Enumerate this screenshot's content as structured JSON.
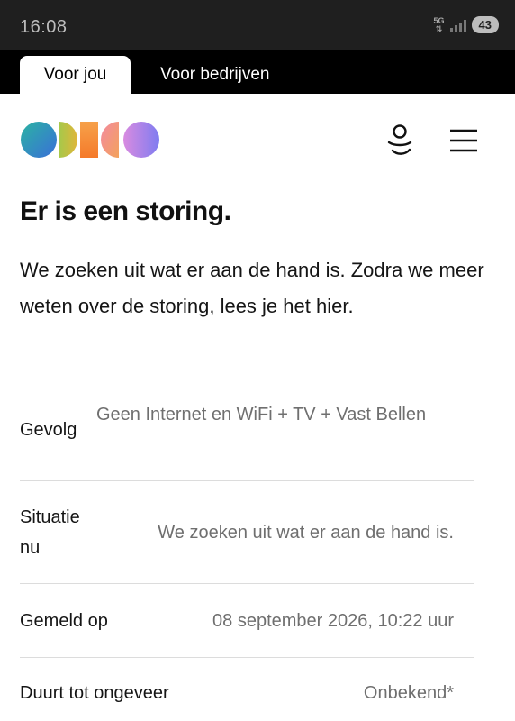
{
  "status_bar": {
    "time": "16:08",
    "network": "5G",
    "battery": "43"
  },
  "tabs": [
    {
      "label": "Voor jou",
      "active": true
    },
    {
      "label": "Voor bedrijven",
      "active": false
    }
  ],
  "header": {
    "logo_icon": "brand-logo",
    "user_icon": "user-icon",
    "menu_icon": "hamburger-menu-icon"
  },
  "colors": {
    "tab_bar": "#000000",
    "status_bar": "#1f1f1f",
    "value_text": "#6f6f6f"
  },
  "main": {
    "title": "Er is een storing.",
    "intro": "We zoeken uit wat er aan de hand is. Zodra we meer weten over de storing, lees je het hier.",
    "rows": [
      {
        "label": "Gevolg",
        "value": "Geen Internet en WiFi + TV + Vast Bellen"
      },
      {
        "label": "Situatie nu",
        "value": "We zoeken uit wat er aan de hand is."
      },
      {
        "label": "Gemeld op",
        "value": "08 september 2026, 10:22 uur"
      },
      {
        "label": "Duurt tot ongeveer",
        "value": "Onbekend*"
      }
    ]
  }
}
